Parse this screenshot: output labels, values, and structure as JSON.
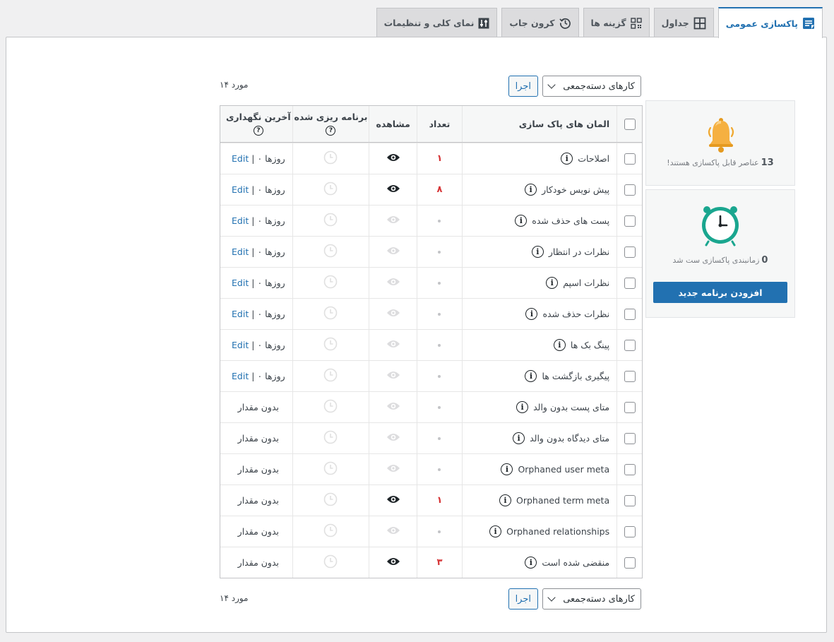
{
  "tabs": [
    {
      "label": "پاکسازی عمومی",
      "icon": "document-lines-icon",
      "active": true
    },
    {
      "label": "جداول",
      "icon": "grid-icon",
      "active": false
    },
    {
      "label": "گزینه ها",
      "icon": "options-grid-icon",
      "active": false
    },
    {
      "label": "کرون جاب",
      "icon": "history-icon",
      "active": false
    },
    {
      "label": "نمای کلی و تنظیمات",
      "icon": "settings-sliders-icon",
      "active": false
    }
  ],
  "bulk": {
    "select_label": "کارهای دسته‌جمعی",
    "apply_label": "اجرا",
    "items_count": "۱۴ مورد"
  },
  "table": {
    "headers": {
      "name": "المان های پاک سازی",
      "count": "تعداد",
      "view": "مشاهده",
      "scheduled": "برنامه ریزی شده",
      "last_kept": "آخرین نگهداری"
    },
    "rows": [
      {
        "name": "اصلاحات",
        "count": "۱",
        "viewable": true,
        "last": "edit",
        "days": "۰ روزها",
        "edit": "Edit"
      },
      {
        "name": "پیش نویس خودکار",
        "count": "۸",
        "viewable": true,
        "last": "edit",
        "days": "۰ روزها",
        "edit": "Edit"
      },
      {
        "name": "پست های حذف شده",
        "count": "",
        "viewable": false,
        "last": "edit",
        "days": "۰ روزها",
        "edit": "Edit"
      },
      {
        "name": "نظرات در انتظار",
        "count": "",
        "viewable": false,
        "last": "edit",
        "days": "۰ روزها",
        "edit": "Edit"
      },
      {
        "name": "نظرات اسپم",
        "count": "",
        "viewable": false,
        "last": "edit",
        "days": "۰ روزها",
        "edit": "Edit"
      },
      {
        "name": "نظرات حذف شده",
        "count": "",
        "viewable": false,
        "last": "edit",
        "days": "۰ روزها",
        "edit": "Edit"
      },
      {
        "name": "پینگ بک ها",
        "count": "",
        "viewable": false,
        "last": "edit",
        "days": "۰ روزها",
        "edit": "Edit"
      },
      {
        "name": "پیگیری بازگشت ها",
        "count": "",
        "viewable": false,
        "last": "edit",
        "days": "۰ روزها",
        "edit": "Edit"
      },
      {
        "name": "متای پست بدون والد",
        "count": "",
        "viewable": false,
        "last": "none",
        "none_text": "بدون مقدار"
      },
      {
        "name": "متای دیدگاه بدون والد",
        "count": "",
        "viewable": false,
        "last": "none",
        "none_text": "بدون مقدار"
      },
      {
        "name": "Orphaned user meta",
        "count": "",
        "viewable": false,
        "last": "none",
        "none_text": "بدون مقدار"
      },
      {
        "name": "Orphaned term meta",
        "count": "۱",
        "viewable": true,
        "last": "none",
        "none_text": "بدون مقدار"
      },
      {
        "name": "Orphaned relationships",
        "count": "",
        "viewable": false,
        "last": "none",
        "none_text": "بدون مقدار"
      },
      {
        "name": "منقضی شده است",
        "count": "۳",
        "viewable": true,
        "last": "none",
        "none_text": "بدون مقدار"
      }
    ]
  },
  "cards": {
    "cleanable": {
      "count": "13",
      "text": "عناصر قابل پاکسازی هستند!",
      "icon": "bell-icon"
    },
    "scheduled": {
      "count": "0",
      "text": "زمانبندی پاکسازی ست شد",
      "icon": "alarm-clock-icon",
      "button": "افزودن برنامه جدید"
    }
  },
  "colors": {
    "accent": "#2271b1",
    "red": "#d63638",
    "bell": "#f0a830",
    "clock": "#1aa68f"
  }
}
